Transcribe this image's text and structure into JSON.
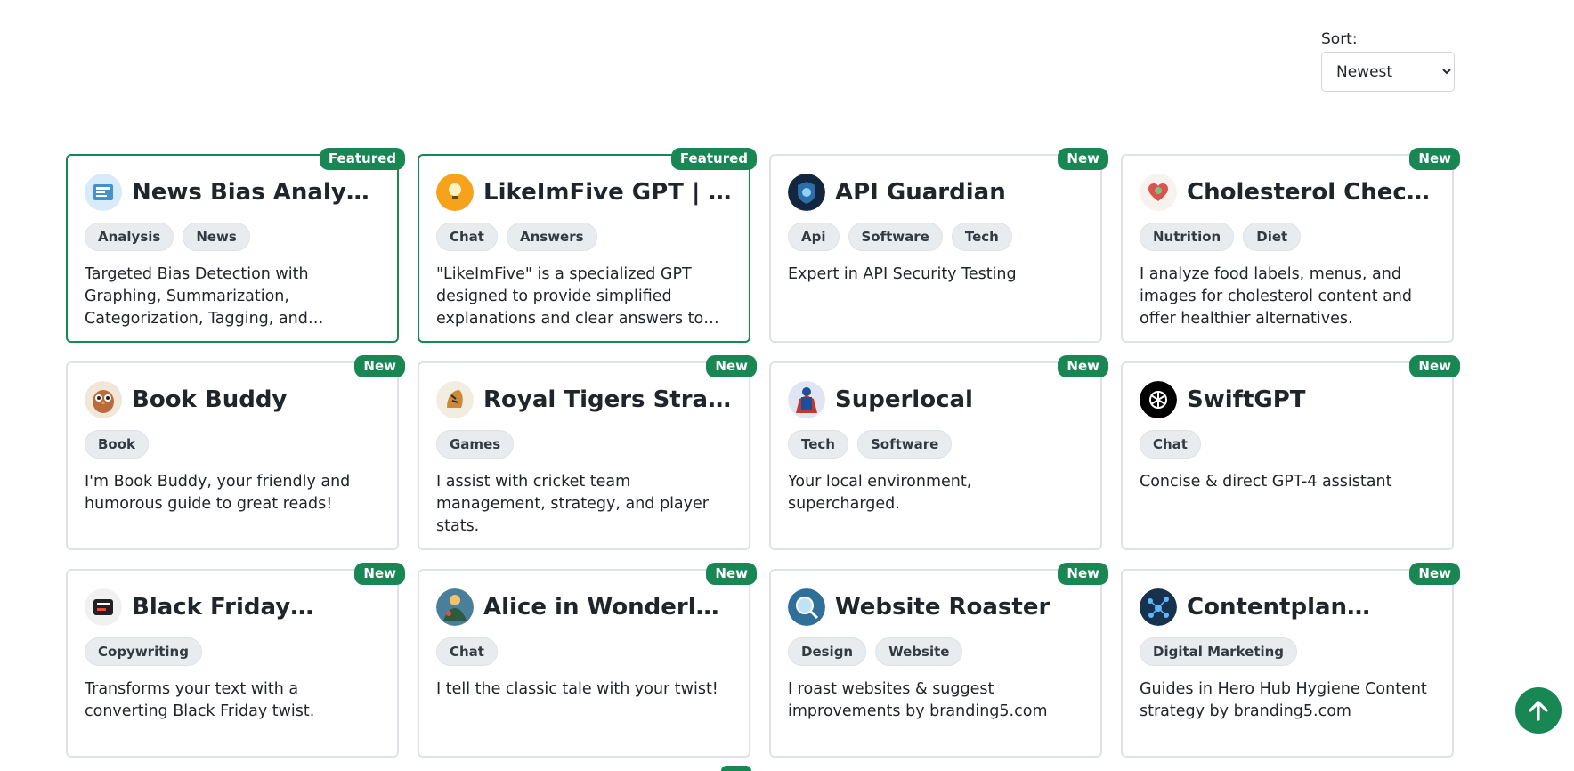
{
  "sort": {
    "label": "Sort:",
    "selected": "Newest"
  },
  "cards": [
    {
      "title": "News Bias Analyzer",
      "badge": "Featured",
      "featured": true,
      "tags": [
        "Analysis",
        "News"
      ],
      "description": "Targeted Bias Detection with Graphing, Summarization, Categorization, Tagging, and Comprehensive Source Evaluation…",
      "icon": "newspaper-icon"
    },
    {
      "title": "LikeImFive GPT | Get…",
      "badge": "Featured",
      "featured": true,
      "tags": [
        "Chat",
        "Answers"
      ],
      "description": "\"LikeImFive\" is a specialized GPT designed to provide simplified explanations and clear answers to a…",
      "icon": "lightbulb-icon"
    },
    {
      "title": "API Guardian",
      "badge": "New",
      "featured": false,
      "tags": [
        "Api",
        "Software",
        "Tech"
      ],
      "description": "Expert in API Security Testing",
      "icon": "shield-icon"
    },
    {
      "title": "Cholesterol Checker",
      "badge": "New",
      "featured": false,
      "tags": [
        "Nutrition",
        "Diet"
      ],
      "description": "I analyze food labels, menus, and images for cholesterol content and offer healthier alternatives.",
      "icon": "heart-icon"
    },
    {
      "title": "Book Buddy",
      "badge": "New",
      "featured": false,
      "tags": [
        "Book"
      ],
      "description": "I'm Book Buddy, your friendly and humorous guide to great reads!",
      "icon": "owl-icon"
    },
    {
      "title": "Royal Tigers Strategist",
      "badge": "New",
      "featured": false,
      "tags": [
        "Games"
      ],
      "description": "I assist with cricket team management, strategy, and player stats.",
      "icon": "tiger-icon"
    },
    {
      "title": "Superlocal",
      "badge": "New",
      "featured": false,
      "tags": [
        "Tech",
        "Software"
      ],
      "description": "Your local environment, supercharged.",
      "icon": "superhero-icon"
    },
    {
      "title": "SwiftGPT",
      "badge": "New",
      "featured": false,
      "tags": [
        "Chat"
      ],
      "description": "Concise & direct GPT-4 assistant",
      "icon": "openai-icon"
    },
    {
      "title": "Black Friday…",
      "badge": "New",
      "featured": false,
      "tags": [
        "Copywriting"
      ],
      "description": "Transforms your text with a converting Black Friday twist.",
      "icon": "black-friday-icon"
    },
    {
      "title": "Alice in Wonderland…",
      "badge": "New",
      "featured": false,
      "tags": [
        "Chat"
      ],
      "description": "I tell the classic tale with your twist!",
      "icon": "wonderland-icon"
    },
    {
      "title": "Website Roaster",
      "badge": "New",
      "featured": false,
      "tags": [
        "Design",
        "Website"
      ],
      "description": "I roast websites & suggest improvements by branding5.com",
      "icon": "magnifier-globe-icon"
    },
    {
      "title": "Contentplan…",
      "badge": "New",
      "featured": false,
      "tags": [
        "Digital Marketing"
      ],
      "description": "Guides in Hero Hub Hygiene Content strategy by branding5.com",
      "icon": "network-icon"
    }
  ],
  "scroll_top_icon": "arrow-up-icon"
}
